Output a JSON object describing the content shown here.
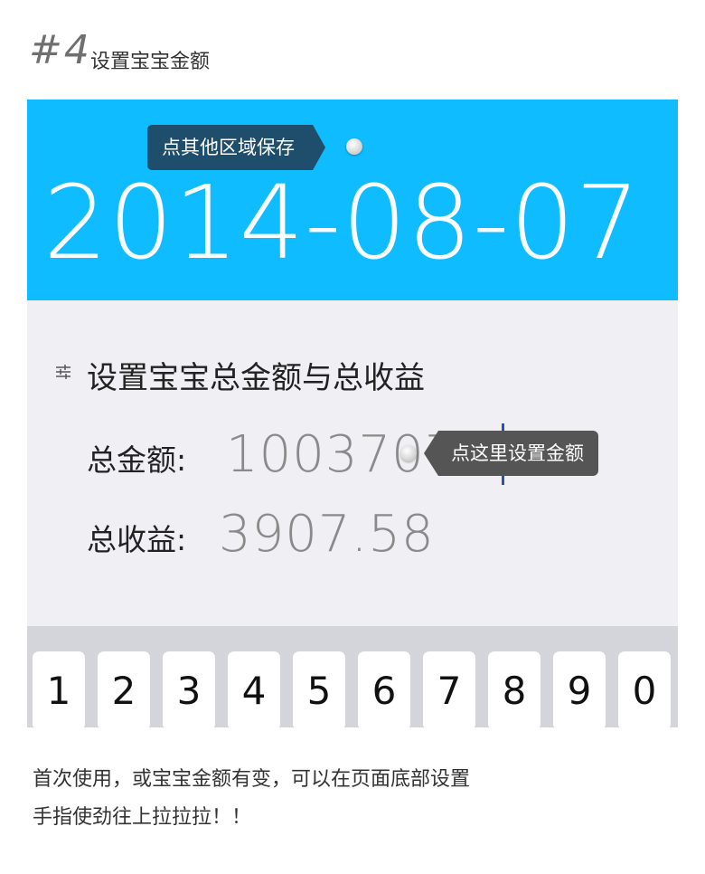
{
  "header": {
    "step_number": "#4",
    "step_title": "设置宝宝金额"
  },
  "hero": {
    "date": "2014-08-07",
    "tooltip_save": "点其他区域保存"
  },
  "settings": {
    "section_title": "设置宝宝总金额与总收益",
    "section_icon": "sliders-icon",
    "amount_label": "总金额:",
    "amount_value": "1003707.59",
    "income_label": "总收益:",
    "income_value": "3907.58",
    "tooltip_set": "点这里设置金额"
  },
  "keyboard": {
    "keys": [
      "1",
      "2",
      "3",
      "4",
      "5",
      "6",
      "7",
      "8",
      "9",
      "0"
    ]
  },
  "caption": {
    "line1": "首次使用，或宝宝金额有变，可以在页面底部设置",
    "line2": "手指使劲往上拉拉拉！！"
  },
  "colors": {
    "hero_blue": "#0ebcff",
    "tooltip_dark": "#1e4e6b",
    "tooltip_grey": "#555555",
    "cursor_blue": "#2a4fb5"
  }
}
